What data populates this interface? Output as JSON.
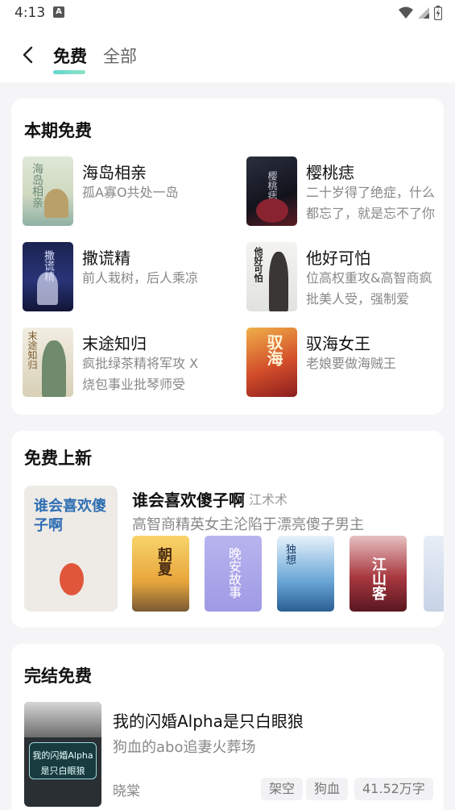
{
  "status_bar": {
    "time": "4:13",
    "badge": "A"
  },
  "header": {
    "tab_free": "免费",
    "tab_all": "全部"
  },
  "section1": {
    "title": "本期免费",
    "books": [
      {
        "name": "海岛相亲",
        "desc": "孤A寡O共处一岛",
        "cover_text": "海岛相亲"
      },
      {
        "name": "樱桃痣",
        "desc": "二十岁得了绝症，什么都忘了，就是忘不了你",
        "cover_text": "樱桃痣"
      },
      {
        "name": "撒谎精",
        "desc": "前人栽树，后人乘凉",
        "cover_text": "撒谎精"
      },
      {
        "name": "他好可怕",
        "desc": "位高权重攻&高智商疯批美人受，强制爱",
        "cover_text": "他好可怕"
      },
      {
        "name": "末途知归",
        "desc": "疯批绿茶精将军攻 X 烧包事业批琴师受",
        "cover_text": "末途知归"
      },
      {
        "name": "驭海女王",
        "desc": "老娘要做海贼王",
        "cover_text": "驭海"
      }
    ]
  },
  "section2": {
    "title": "免费上新",
    "feature": {
      "title": "谁会喜欢傻子啊",
      "author": "江术术",
      "desc": "高智商精英女主沦陷于漂亮傻子男主",
      "cover_text": "谁会喜欢傻子啊"
    },
    "covers": [
      {
        "cover_text": "朝夏"
      },
      {
        "cover_text": "晚安故事"
      },
      {
        "cover_text": "独想"
      },
      {
        "cover_text": "江山客"
      }
    ]
  },
  "section3": {
    "title": "完结免费",
    "book": {
      "title": "我的闪婚Alpha是只白眼狼",
      "desc": "狗血的abo追妻火葬场",
      "author": "晓棠",
      "tags": [
        "架空",
        "狗血",
        "41.52万字"
      ],
      "cover_text_1": "我的闪婚Alpha",
      "cover_text_2": "是只白眼狼"
    }
  }
}
